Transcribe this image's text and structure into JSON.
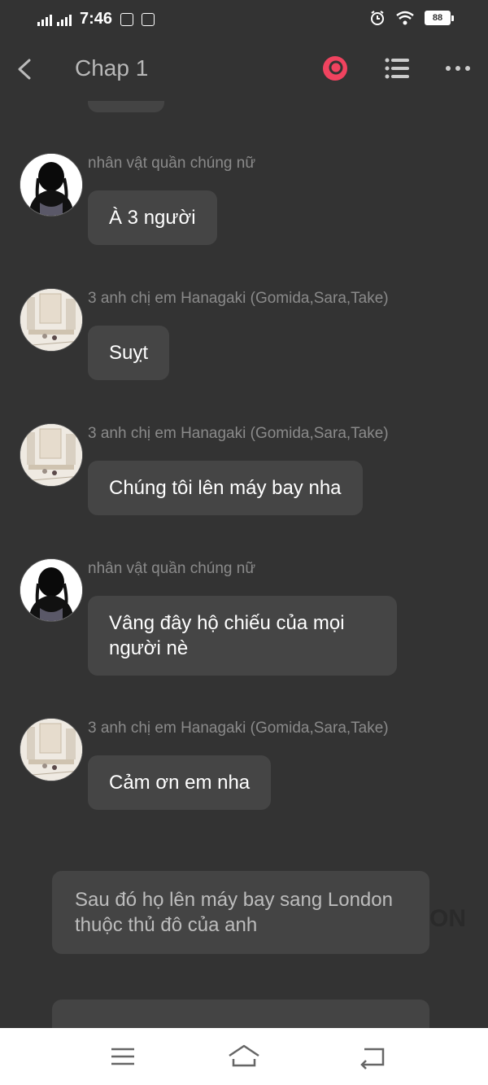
{
  "status_bar": {
    "time": "7:46",
    "battery": "88",
    "badge_1": "Zalo",
    "badge_2": "BÁO MỚI"
  },
  "header": {
    "title": "Chap 1"
  },
  "colors": {
    "record_accent": "#f0435f",
    "background": "#333333",
    "bubble": "#454545"
  },
  "messages": [
    {
      "sender": "nhân vật quần chúng nữ",
      "text": "À 3 người",
      "avatar": "silhouette"
    },
    {
      "sender": "3 anh chị em Hanagaki (Gomida,Sara,Take)",
      "text": "Suỵt",
      "avatar": "room-scene"
    },
    {
      "sender": "3 anh chị em Hanagaki (Gomida,Sara,Take)",
      "text": "Chúng tôi lên máy bay nha",
      "avatar": "room-scene"
    },
    {
      "sender": "nhân vật quần chúng nữ",
      "text": "Vâng đây hộ chiếu của mọi người nè",
      "avatar": "silhouette"
    },
    {
      "sender": "3 anh chị em Hanagaki (Gomida,Sara,Take)",
      "text": "Cảm ơn em nha",
      "avatar": "room-scene"
    }
  ],
  "narration": [
    {
      "text": "Sau đó họ lên máy bay sang London thuộc thủ đô của anh"
    },
    {
      "text": ""
    }
  ],
  "watermark": "ON",
  "icons": {
    "back": "chevron-left-icon",
    "record": "record-icon",
    "list": "list-icon",
    "more": "more-icon",
    "nav_menu": "menu-icon",
    "nav_home": "home-icon",
    "nav_back": "return-icon"
  }
}
